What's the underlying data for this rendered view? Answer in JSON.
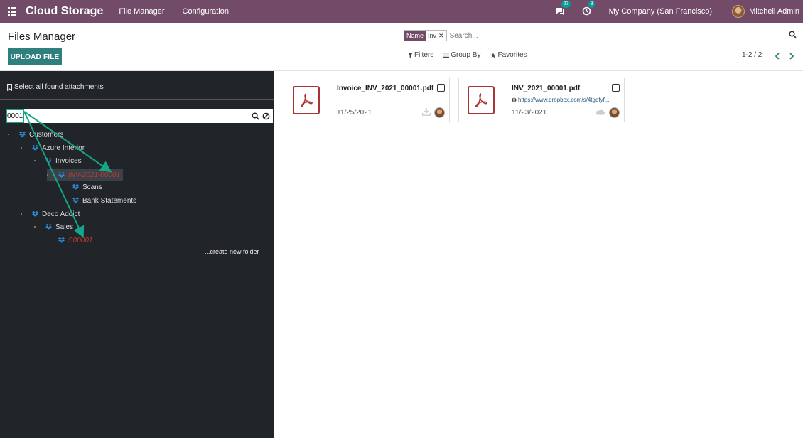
{
  "navbar": {
    "brand": "Cloud Storage",
    "menus": [
      "File Manager",
      "Configuration"
    ],
    "messages_count": "27",
    "activities_count": "8",
    "company": "My Company (San Francisco)",
    "user": "Mitchell Admin",
    "bg_color": "#714B67"
  },
  "control_panel": {
    "title": "Files Manager",
    "upload_label": "UPLOAD FILE",
    "search": {
      "facet_label": "Name",
      "facet_value": "Inv",
      "placeholder": "Search..."
    },
    "filters_label": "Filters",
    "group_by_label": "Group By",
    "favorites_label": "Favorites",
    "pager": "1-2 / 2"
  },
  "sidebar": {
    "select_all_label": "Select all found attachments",
    "search_value": "0001",
    "tree": [
      {
        "label": "Customers",
        "style": "normal"
      },
      {
        "label": "Azure Interior",
        "style": "normal"
      },
      {
        "label": "Invoices",
        "style": "normal"
      },
      {
        "label": "INV-2021-00001",
        "style": "italic-red"
      },
      {
        "label": "Scans",
        "style": "normal"
      },
      {
        "label": "Bank Statements",
        "style": "normal"
      },
      {
        "label": "Deco Addict",
        "style": "normal"
      },
      {
        "label": "Sales",
        "style": "normal"
      },
      {
        "label": "S00001",
        "style": "italic-red"
      }
    ],
    "create_folder_label": "...create new folder"
  },
  "cards": [
    {
      "name": "Invoice_INV_2021_00001.pdf",
      "url": "",
      "date": "11/25/2021",
      "status_icon": "download-icon"
    },
    {
      "name": "INV_2021_00001.pdf",
      "url": "https://www.dropbox.com/s/4tgqfyf...",
      "date": "11/23/2021",
      "status_icon": "cloud-icon"
    }
  ],
  "colors": {
    "accent": "#2e7f7d",
    "annotation": "#17a589",
    "pdf_red": "#a33333"
  }
}
